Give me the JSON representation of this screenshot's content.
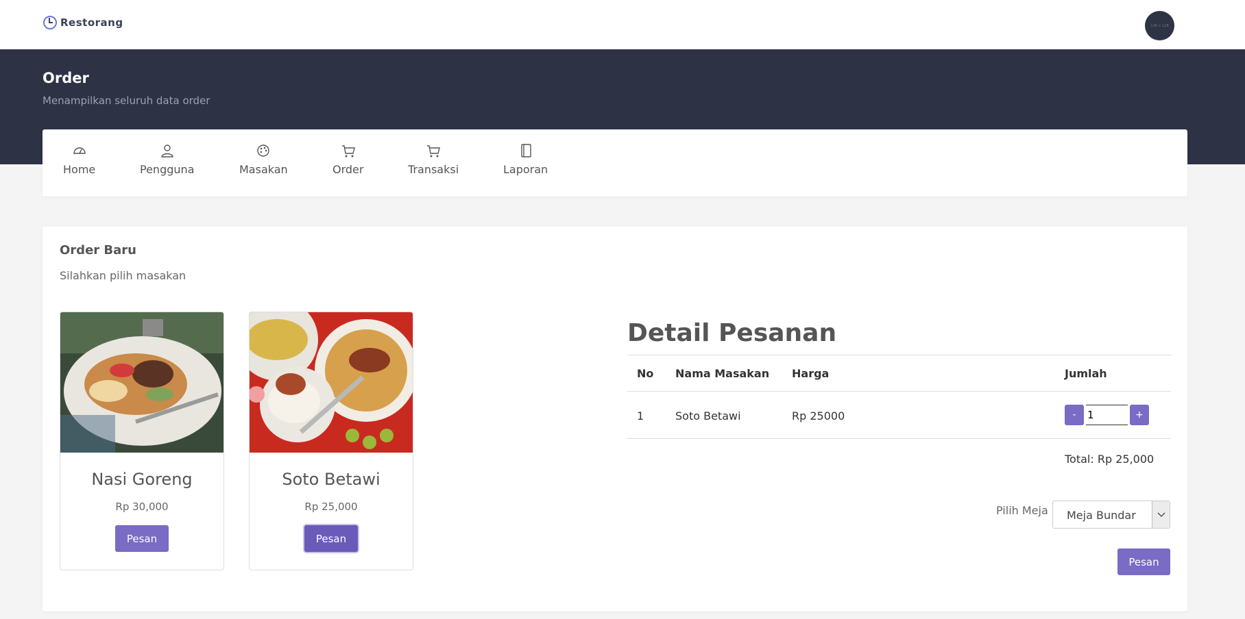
{
  "app": {
    "name": "Restorang",
    "avatar_text": "128 × 128"
  },
  "header": {
    "title": "Order",
    "subtitle": "Menampilkan seluruh data order"
  },
  "nav": [
    {
      "label": "Home",
      "icon": "dashboard-icon"
    },
    {
      "label": "Pengguna",
      "icon": "user-icon"
    },
    {
      "label": "Masakan",
      "icon": "palette-icon"
    },
    {
      "label": "Order",
      "icon": "cart-icon"
    },
    {
      "label": "Transaksi",
      "icon": "cart-icon"
    },
    {
      "label": "Laporan",
      "icon": "notebook-icon"
    }
  ],
  "order": {
    "title": "Order Baru",
    "subtitle": "Silahkan pilih masakan",
    "menu": [
      {
        "name": "Nasi Goreng",
        "price": "Rp 30,000",
        "button": "Pesan"
      },
      {
        "name": "Soto Betawi",
        "price": "Rp 25,000",
        "button": "Pesan"
      }
    ]
  },
  "detail": {
    "title": "Detail Pesanan",
    "columns": [
      "No",
      "Nama Masakan",
      "Harga",
      "Jumlah"
    ],
    "rows": [
      {
        "no": "1",
        "name": "Soto Betawi",
        "price": "Rp 25000",
        "qty": "1"
      }
    ],
    "minus": "-",
    "plus": "+",
    "total": "Total: Rp 25,000",
    "table_label": "Pilih Meja",
    "table_value": "Meja Bundar",
    "submit": "Pesan"
  },
  "colors": {
    "accent": "#7a6bc4",
    "hero": "#2d3245"
  }
}
